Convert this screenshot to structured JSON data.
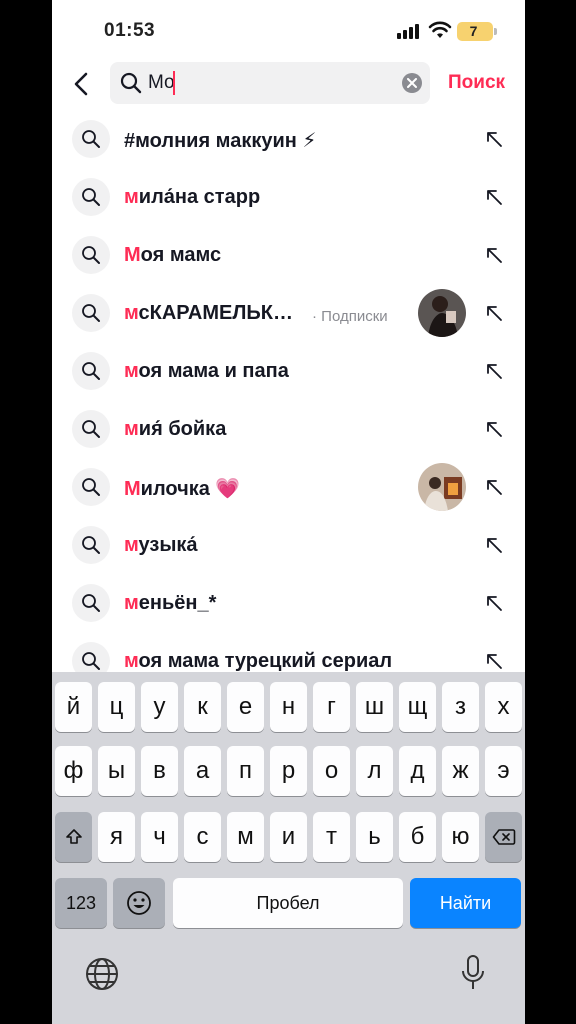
{
  "status_bar": {
    "time": "01:53",
    "battery": "7"
  },
  "search": {
    "value": "Мо",
    "submit_label": "Поиск"
  },
  "suggestions": [
    {
      "highlight": "",
      "rest": "#молния маккуин ⚡",
      "subtitle": "",
      "avatar": false
    },
    {
      "highlight": "м",
      "rest": "ила́на старр",
      "subtitle": "",
      "avatar": false
    },
    {
      "highlight": "М",
      "rest": "оя мамс",
      "subtitle": "",
      "avatar": false
    },
    {
      "highlight": "м",
      "rest": "сКАРАМЕЛЬК…",
      "subtitle": "· Подписки",
      "avatar": true
    },
    {
      "highlight": "м",
      "rest": "оя мама и папа",
      "subtitle": "",
      "avatar": false
    },
    {
      "highlight": "м",
      "rest": "ия́ бойка",
      "subtitle": "",
      "avatar": false
    },
    {
      "highlight": "М",
      "rest": "илочка 💗",
      "subtitle": "",
      "avatar": true
    },
    {
      "highlight": "м",
      "rest": "узыка́",
      "subtitle": "",
      "avatar": false
    },
    {
      "highlight": "м",
      "rest": "еньён_*",
      "subtitle": "",
      "avatar": false
    },
    {
      "highlight": "м",
      "rest": "оя мама турецкий сериал",
      "subtitle": "",
      "avatar": false
    }
  ],
  "keyboard": {
    "row1": [
      "й",
      "ц",
      "у",
      "к",
      "е",
      "н",
      "г",
      "ш",
      "щ",
      "з",
      "х"
    ],
    "row2": [
      "ф",
      "ы",
      "в",
      "а",
      "п",
      "р",
      "о",
      "л",
      "д",
      "ж",
      "э"
    ],
    "row3": [
      "я",
      "ч",
      "с",
      "м",
      "и",
      "т",
      "ь",
      "б",
      "ю"
    ],
    "numbers_label": "123",
    "space_label": "Пробел",
    "go_label": "Найти"
  },
  "colors": {
    "accent": "#fe2c55",
    "keyboard_bg": "#d4d5da",
    "go_key": "#0a84ff"
  },
  "icons": {
    "back": "chevron-left-icon",
    "search": "search-icon",
    "clear": "clear-icon",
    "arrow": "arrow-up-left-icon",
    "shift": "shift-icon",
    "delete": "backspace-icon",
    "emoji": "emoji-icon",
    "globe": "globe-icon",
    "mic": "microphone-icon"
  }
}
